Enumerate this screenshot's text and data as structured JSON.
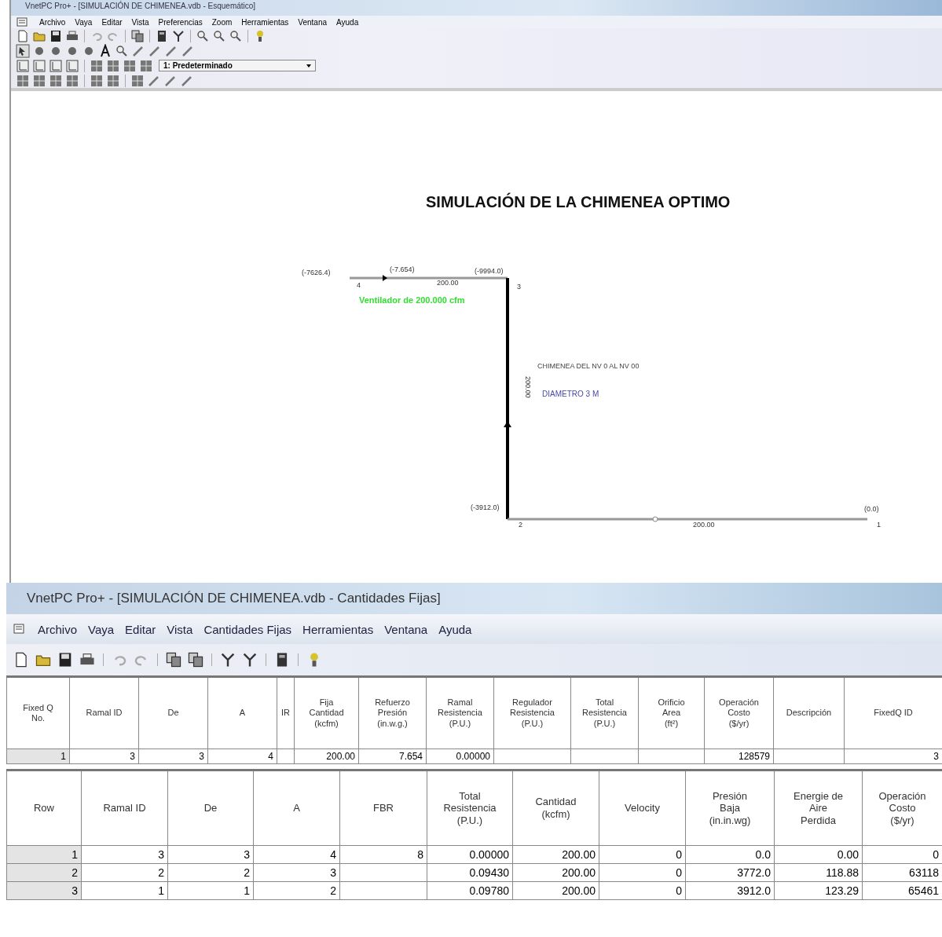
{
  "schematic_window": {
    "title": "VnetPC Pro+ - [SIMULACIÓN DE CHIMENEA.vdb - Esquemático]",
    "menu": [
      "Archivo",
      "Vaya",
      "Editar",
      "Vista",
      "Preferencias",
      "Zoom",
      "Herramientas",
      "Ventana",
      "Ayuda"
    ],
    "layer_select": {
      "value": "1: Predeterminado"
    },
    "diagram": {
      "title": "SIMULACIÓN DE LA CHIMENEA OPTIMO",
      "labels": [
        {
          "kind": "pressure",
          "text": "(-7626.4)"
        },
        {
          "kind": "pressure",
          "text": "(-7.654)"
        },
        {
          "kind": "pressure",
          "text": "(-9994.0)"
        },
        {
          "kind": "length",
          "text": "200.00"
        },
        {
          "kind": "node",
          "text": "4"
        },
        {
          "kind": "node",
          "text": "3"
        },
        {
          "kind": "fan",
          "text": "Ventilador de 200.000 cfm"
        },
        {
          "kind": "note",
          "text": "CHIMENEA DEL NV 0 AL NV 00"
        },
        {
          "kind": "note-blue",
          "text": "DIAMETRO 3 M"
        },
        {
          "kind": "length-vertical",
          "text": "200.00"
        },
        {
          "kind": "pressure",
          "text": "(-3912.0)"
        },
        {
          "kind": "length",
          "text": "200.00"
        },
        {
          "kind": "pressure",
          "text": "(0.0)"
        },
        {
          "kind": "node",
          "text": "2"
        },
        {
          "kind": "node",
          "text": "1"
        }
      ]
    }
  },
  "fixed_window": {
    "title": "VnetPC Pro+ - [SIMULACIÓN DE CHIMENEA.vdb - Cantidades Fijas]",
    "menu": [
      "Archivo",
      "Vaya",
      "Editar",
      "Vista",
      "Cantidades Fijas",
      "Herramientas",
      "Ventana",
      "Ayuda"
    ],
    "fixed_table": {
      "columns": [
        "Fixed Q\nNo.",
        "Ramal ID",
        "De",
        "A",
        "IR",
        "Fija\nCantidad\n(kcfm)",
        "Refuerzo\nPresión\n(in.w.g.)",
        "Ramal\nResistencia\n(P.U.)",
        "Regulador\nResistencia\n(P.U.)",
        "Total\nResistencia\n(P.U.)",
        "Orificio\nArea\n(ft²)",
        "Operación\nCosto\n($/yr)",
        "Descripción",
        "FixedQ ID"
      ],
      "rows": [
        [
          "1",
          "3",
          "3",
          "4",
          null,
          "200.00",
          "7.654",
          "0.00000",
          null,
          null,
          null,
          "128579",
          null,
          "3"
        ]
      ]
    },
    "results_table": {
      "columns": [
        "Row",
        "Ramal ID",
        "De",
        "A",
        "FBR",
        "Total\nResistencia\n(P.U.)",
        "Cantidad\n(kcfm)",
        "Velocity",
        "Presión\nBaja\n(in.in.wg)",
        "Energie de\nAire\nPerdida",
        "Operación\nCosto\n($/yr)"
      ],
      "rows": [
        [
          "1",
          "3",
          "3",
          "4",
          "8",
          "0.00000",
          "200.00",
          "0",
          "0.0",
          "0.00",
          "0"
        ],
        [
          "2",
          "2",
          "2",
          "3",
          null,
          "0.09430",
          "200.00",
          "0",
          "3772.0",
          "118.88",
          "63118"
        ],
        [
          "3",
          "1",
          "1",
          "2",
          null,
          "0.09780",
          "200.00",
          "0",
          "3912.0",
          "123.29",
          "65461"
        ]
      ]
    }
  }
}
